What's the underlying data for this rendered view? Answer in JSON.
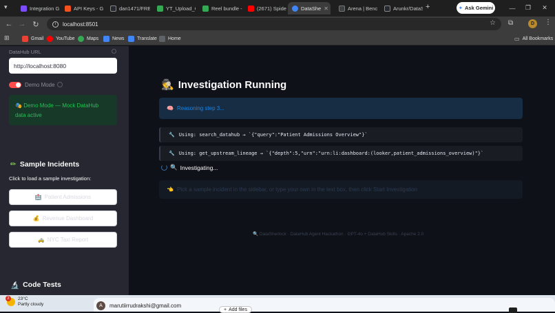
{
  "browser": {
    "tabs": [
      {
        "label": "Integration Gu",
        "color": "#7c4dff"
      },
      {
        "label": "API Keys - Gro",
        "color": "#f4511e"
      },
      {
        "label": "dan1471/FREE",
        "color": "#24292f"
      },
      {
        "label": "YT_Upload_Co",
        "color": "#34a853"
      },
      {
        "label": "Reel bundle -",
        "color": "#34a853"
      },
      {
        "label": "(2671) Spider-",
        "color": "#ff0000"
      },
      {
        "label": "DataShe",
        "color": "#4285f4"
      },
      {
        "label": "Arena | Bench",
        "color": "#3c4043"
      },
      {
        "label": "Arunkr/DataSh",
        "color": "#24292f"
      }
    ],
    "new_tab": "+",
    "gemini_label": "Ask Gemini",
    "url": "localhost:8501",
    "profile_initial": "D",
    "bookmarks": [
      {
        "label": "Gmail",
        "color": "#ea4335"
      },
      {
        "label": "YouTube",
        "color": "#ff0000"
      },
      {
        "label": "Maps",
        "color": "#34a853"
      },
      {
        "label": "News",
        "color": "#4285f4"
      },
      {
        "label": "Translate",
        "color": "#4285f4"
      },
      {
        "label": "Home",
        "color": "#5f6368"
      }
    ],
    "all_bookmarks": "All Bookmarks"
  },
  "sidebar": {
    "datahub_url_label": "DataHub URL",
    "datahub_url_value": "http://localhost:8080",
    "demo_mode_label": "Demo Mode",
    "demo_notice_line1": "Demo Mode — Mock DataHub",
    "demo_notice_line2": "data active",
    "sample_incidents_title": "Sample Incidents",
    "sample_incidents_hint": "Click to load a sample investigation:",
    "sample_buttons": [
      "Patient Admissions",
      "Revenue Dashboard",
      "NYC Taxi Report"
    ],
    "code_tests_title": "Code Tests"
  },
  "main": {
    "title": "Investigation Running",
    "reasoning": "Reasoning step 3...",
    "tool_calls": [
      "Using: search_datahub → `{\"query\":\"Patient Admissions Overview\"}`",
      "Using: get_upstream_lineage → `{\"depth\":5,\"urn\":\"urn:li:dashboard:(looker,patient_admissions_overview)\"}`"
    ],
    "investigating": "Investigating...",
    "hint": "Pick a sample incident in the sidebar, or type your own in the text box, then click Start Investigation",
    "footer": "DataSherlock · DataHub Agent Hackathon · GPT-4o + DataHub Skills · Apache 2.0"
  },
  "taskbar": {
    "temp": "23°C",
    "weather": "Partly cloudy",
    "notif_count": "2",
    "email": "marutiirrudrakshi@gmail.com",
    "avatar_initial": "A",
    "add_files": "Add files"
  }
}
